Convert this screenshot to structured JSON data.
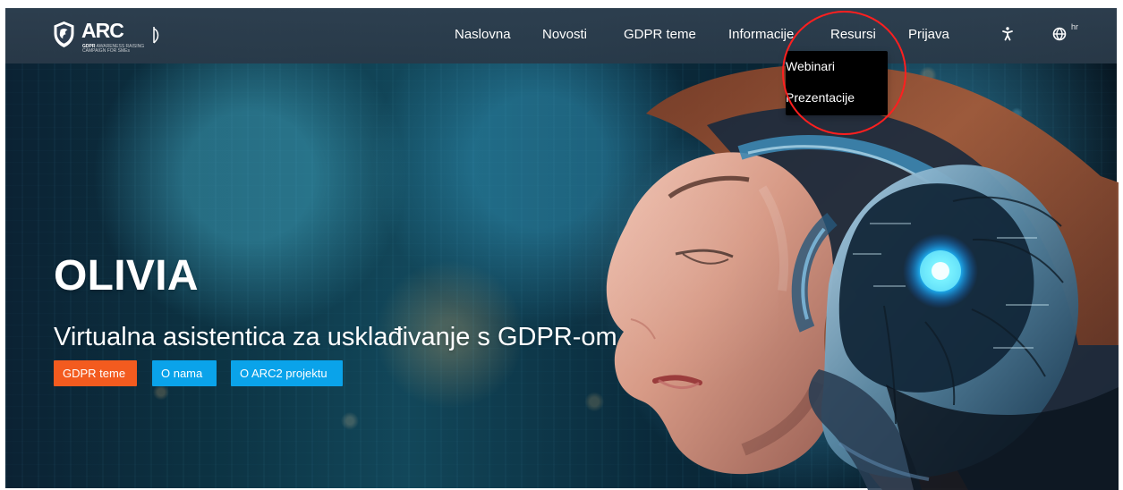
{
  "window": {
    "width": 1255,
    "height": 548
  },
  "brand": {
    "name": "ARC",
    "tagline_prefix": "GDPR",
    "tagline_middle": "AWARENESS RAISING",
    "tagline_suffix": "CAMPAIGN FOR SMEs"
  },
  "nav": {
    "items": [
      {
        "label": "Naslovna"
      },
      {
        "label": "Novosti"
      },
      {
        "label": "GDPR teme"
      },
      {
        "label": "Informacije"
      },
      {
        "label": "Resursi"
      },
      {
        "label": "Prijava"
      }
    ],
    "language_code": "hr"
  },
  "dropdown": {
    "items": [
      {
        "label": "Webinari"
      },
      {
        "label": "Prezentacije"
      }
    ]
  },
  "hero": {
    "title": "OLIVIA",
    "subtitle": "Virtualna asistentica za usklađivanje s GDPR-om",
    "buttons": [
      {
        "label": "GDPR teme",
        "color": "#f35b1f"
      },
      {
        "label": "O nama",
        "color": "#0aa3ea"
      },
      {
        "label": "O ARC2 projektu",
        "color": "#0aa3ea"
      }
    ]
  },
  "icons": {
    "brand": "shield-logo-icon",
    "brand_side": "shield-outline-icon",
    "accessibility": "accessibility-icon",
    "language": "globe-icon"
  },
  "colors": {
    "navbar": "#2e3f4f",
    "dropdown": "#000000",
    "annotation": "#ff1f1f",
    "orange_button": "#f35b1f",
    "blue_button": "#0aa3ea"
  }
}
